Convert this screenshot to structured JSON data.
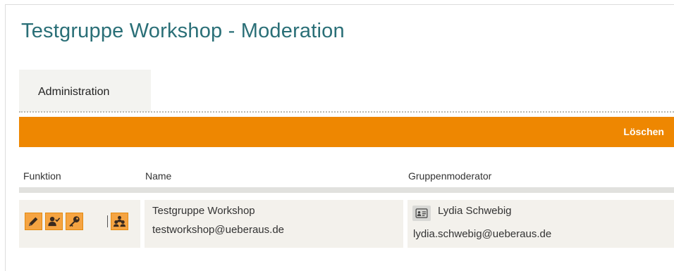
{
  "page": {
    "title": "Testgruppe Workshop - Moderation"
  },
  "tabs": [
    {
      "label": "Administration",
      "active": true
    }
  ],
  "toolbar": {
    "delete_label": "Löschen",
    "accent_color": "#ee8701"
  },
  "table": {
    "headers": {
      "function": "Funktion",
      "name": "Name",
      "moderator": "Gruppenmoderator"
    },
    "rows": [
      {
        "function_icons": [
          "edit-icon",
          "member-check-icon",
          "key-icon",
          "group-icon"
        ],
        "name": "Testgruppe Workshop",
        "email": "testworkshop@ueberaus.de",
        "moderator": {
          "icon": "contact-card-icon",
          "name": "Lydia Schwebig",
          "email": "lydia.schwebig@ueberaus.de"
        }
      }
    ]
  }
}
